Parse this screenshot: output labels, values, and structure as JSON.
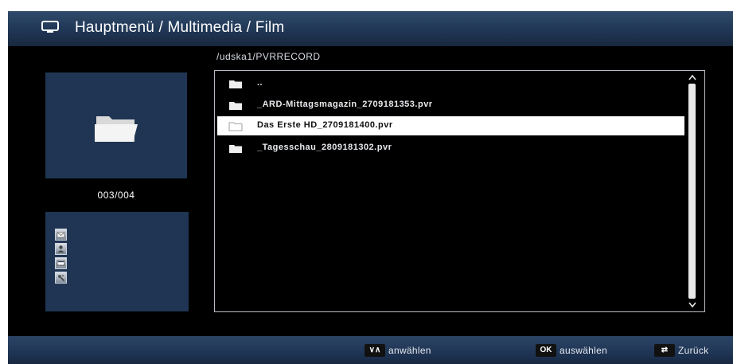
{
  "header": {
    "title": "Hauptmenü / Multimedia / Film",
    "icon": "tv-icon"
  },
  "path": "/udska1/PVRRECORD",
  "counter": "003/004",
  "files": [
    {
      "name": "..",
      "icon": "folder-icon",
      "selected": false
    },
    {
      "name": "_ARD-Mittagsmagazin_2709181353.pvr",
      "icon": "folder-icon",
      "selected": false
    },
    {
      "name": "Das Erste HD_2709181400.pvr",
      "icon": "folder-icon",
      "selected": true
    },
    {
      "name": "_Tagesschau_2809181302.pvr",
      "icon": "folder-icon",
      "selected": false
    }
  ],
  "info_icons": [
    "envelope-icon",
    "person-icon",
    "display-icon",
    "tools-icon"
  ],
  "footer": {
    "select_key": "∨∧",
    "select_label": "anwählen",
    "ok_key": "OK",
    "ok_label": "auswählen",
    "back_key": "⇄",
    "back_label": "Zurück"
  },
  "colors": {
    "panel": "#1f3553",
    "header": "#2f4a6b",
    "selected_row": "#ffffff",
    "background": "#000000"
  }
}
